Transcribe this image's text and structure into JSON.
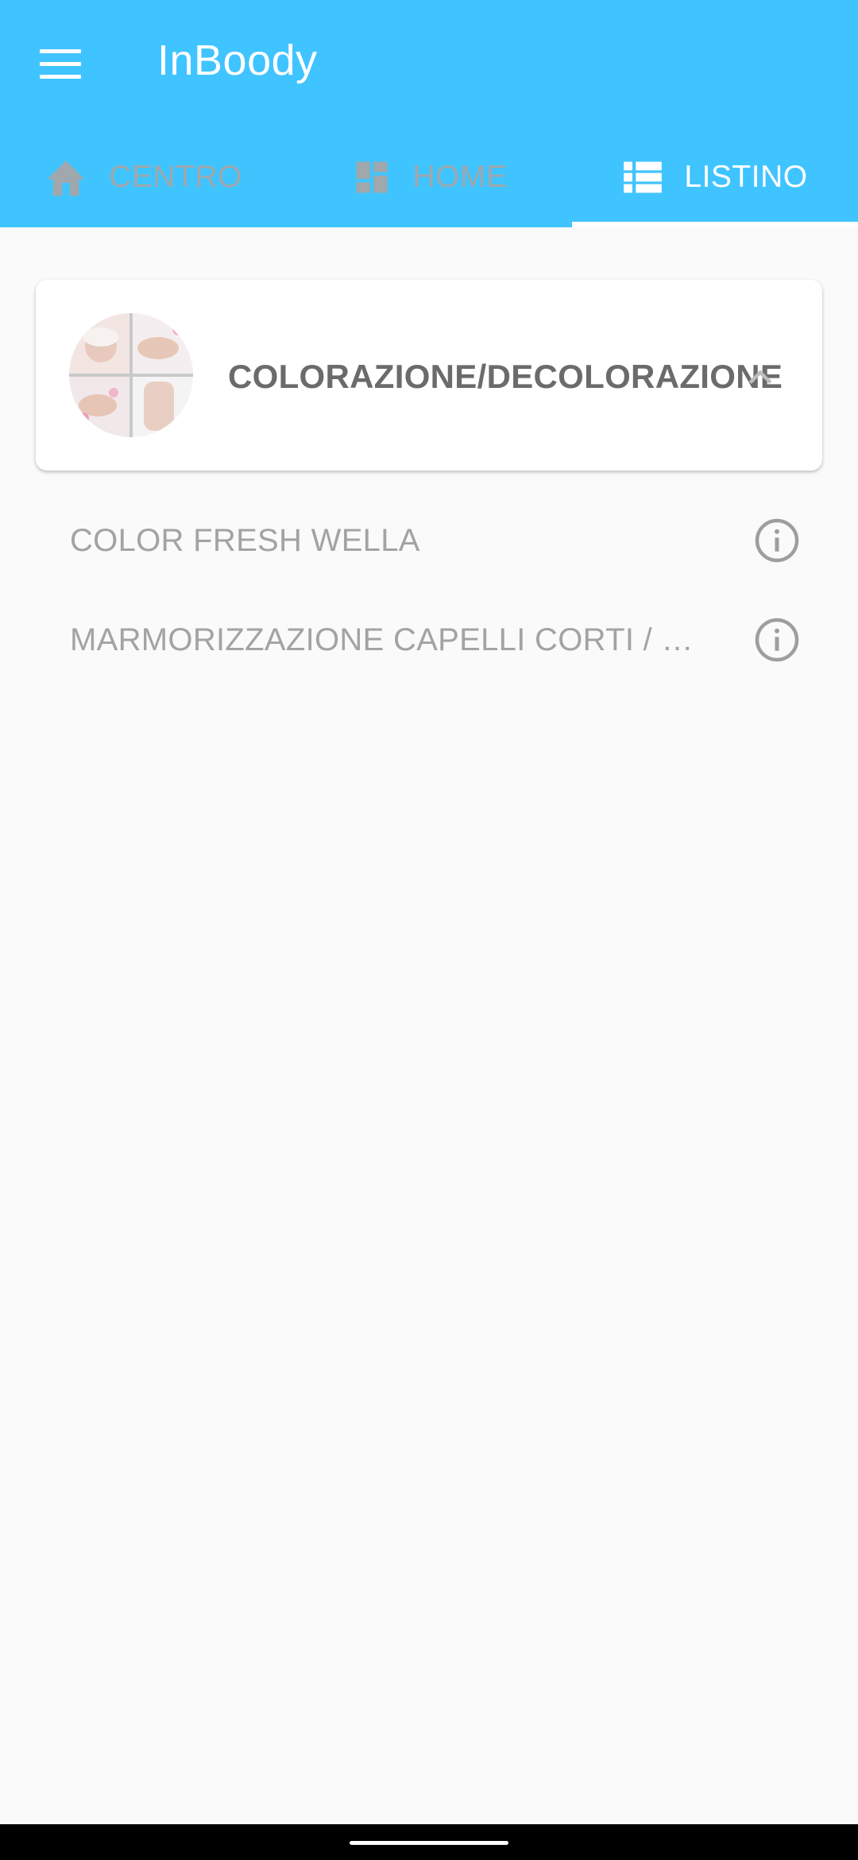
{
  "app": {
    "title": "InBoody",
    "accent_color": "#40c4ff",
    "menu_icon": "menu-icon"
  },
  "tabs": [
    {
      "label": "CENTRO",
      "icon": "home-icon",
      "active": false
    },
    {
      "label": "HOME",
      "icon": "dashboard-icon",
      "active": false
    },
    {
      "label": "LISTINO",
      "icon": "list-icon",
      "active": true
    }
  ],
  "category": {
    "title": "COLORAZIONE/DECOLORAZIONE",
    "image": "beauty-collage-avatar",
    "expanded": true,
    "toggle_icon": "chevron-up-icon"
  },
  "items": [
    {
      "label": "COLOR FRESH WELLA",
      "icon": "info-icon"
    },
    {
      "label": "MARMORIZZAZIONE CAPELLI CORTI / …",
      "icon": "info-icon"
    }
  ]
}
